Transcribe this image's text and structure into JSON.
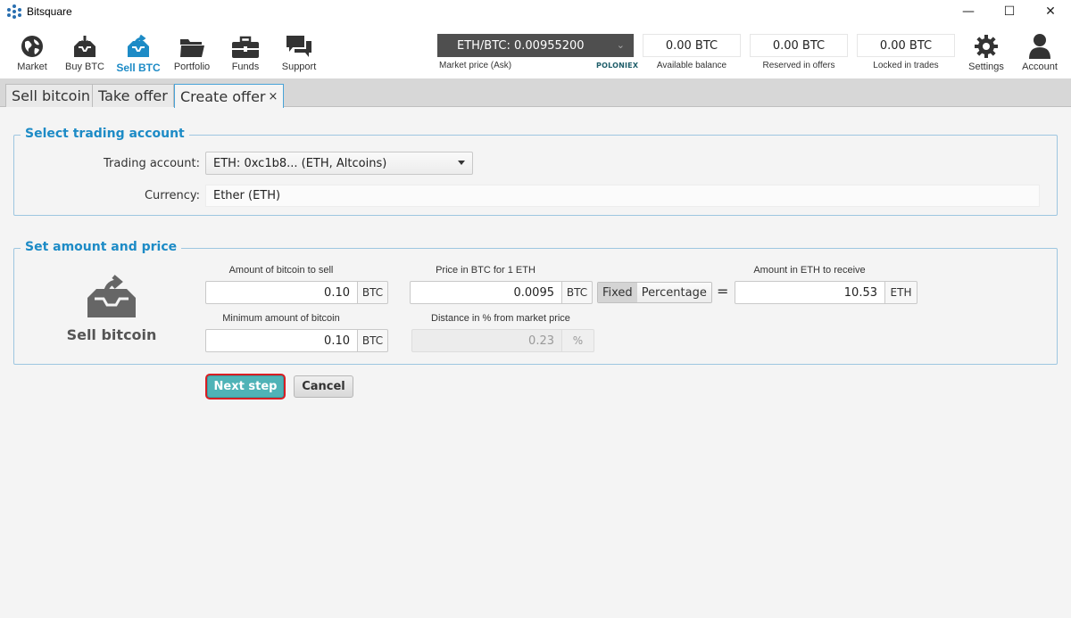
{
  "window": {
    "title": "Bitsquare",
    "minimize_glyph": "—",
    "maximize_glyph": "☐",
    "close_glyph": "✕"
  },
  "nav": [
    {
      "label": "Market",
      "icon": "globe-icon",
      "active": false
    },
    {
      "label": "Buy BTC",
      "icon": "buy-inbox-icon",
      "active": false
    },
    {
      "label": "Sell BTC",
      "icon": "sell-inbox-icon",
      "active": true
    },
    {
      "label": "Portfolio",
      "icon": "folder-icon",
      "active": false
    },
    {
      "label": "Funds",
      "icon": "briefcase-icon",
      "active": false
    },
    {
      "label": "Support",
      "icon": "chat-icon",
      "active": false
    }
  ],
  "market": {
    "selector_value": "ETH/BTC: 0.00955200",
    "chevron": "⌄",
    "caption": "Market price (Ask)",
    "provider": "POLONIEX"
  },
  "balances": [
    {
      "value": "0.00 BTC",
      "caption": "Available balance"
    },
    {
      "value": "0.00 BTC",
      "caption": "Reserved in offers"
    },
    {
      "value": "0.00 BTC",
      "caption": "Locked in trades"
    }
  ],
  "right_nav": [
    {
      "label": "Settings",
      "icon": "gear-icon"
    },
    {
      "label": "Account",
      "icon": "user-icon"
    }
  ],
  "tabs": [
    {
      "label": "Sell bitcoin",
      "active": false
    },
    {
      "label": "Take offer",
      "active": false
    },
    {
      "label": "Create offer",
      "active": true,
      "close": "×"
    }
  ],
  "trading_account": {
    "group_title": "Select trading account",
    "account_label": "Trading account:",
    "account_value": "ETH: 0xc1b8... (ETH, Altcoins)",
    "currency_label": "Currency:",
    "currency_value": "Ether (ETH)"
  },
  "amount_price": {
    "group_title": "Set amount and price",
    "side_label": "Sell bitcoin",
    "amount_label": "Amount of bitcoin to sell",
    "amount_value": "0.10",
    "amount_unit": "BTC",
    "min_amount_label": "Minimum amount of bitcoin",
    "min_amount_value": "0.10",
    "min_amount_unit": "BTC",
    "price_label": "Price in BTC for 1 ETH",
    "price_value": "0.0095",
    "price_unit": "BTC",
    "distance_label": "Distance in % from market price",
    "distance_value": "0.23",
    "distance_unit": "%",
    "toggle_fixed": "Fixed",
    "toggle_percentage": "Percentage",
    "equals": "=",
    "receive_label": "Amount in ETH to receive",
    "receive_value": "10.53",
    "receive_unit": "ETH"
  },
  "actions": {
    "next_label": "Next step",
    "cancel_label": "Cancel"
  },
  "colors": {
    "accent": "#1d8bc6",
    "primary_button": "#4fb3b7",
    "highlight_ring": "#d81e23",
    "market_box": "#4f4f4f"
  }
}
